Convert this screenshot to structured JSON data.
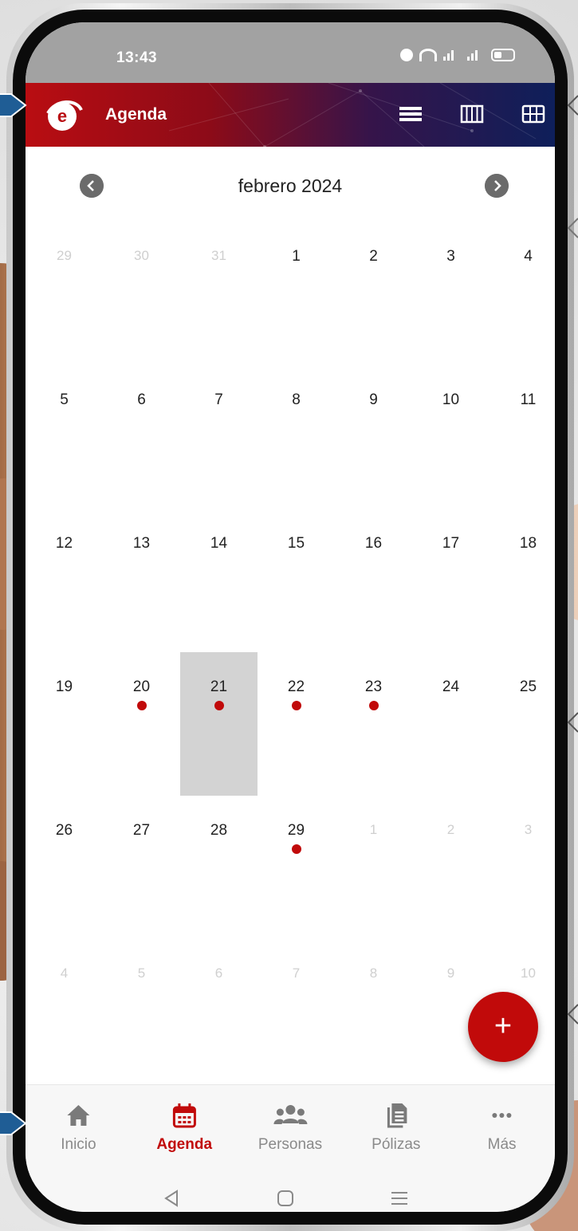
{
  "status_bar": {
    "time": "13:43"
  },
  "app_bar": {
    "title": "Agenda"
  },
  "calendar": {
    "month_label": "febrero 2024",
    "weeks": [
      [
        {
          "d": "29",
          "m": true
        },
        {
          "d": "30",
          "m": true
        },
        {
          "d": "31",
          "m": true
        },
        {
          "d": "1"
        },
        {
          "d": "2"
        },
        {
          "d": "3"
        },
        {
          "d": "4"
        }
      ],
      [
        {
          "d": "5"
        },
        {
          "d": "6"
        },
        {
          "d": "7"
        },
        {
          "d": "8"
        },
        {
          "d": "9"
        },
        {
          "d": "10"
        },
        {
          "d": "11"
        }
      ],
      [
        {
          "d": "12"
        },
        {
          "d": "13"
        },
        {
          "d": "14"
        },
        {
          "d": "15"
        },
        {
          "d": "16"
        },
        {
          "d": "17"
        },
        {
          "d": "18"
        }
      ],
      [
        {
          "d": "19"
        },
        {
          "d": "20",
          "dot": true
        },
        {
          "d": "21",
          "dot": true,
          "selected": true
        },
        {
          "d": "22",
          "dot": true
        },
        {
          "d": "23",
          "dot": true
        },
        {
          "d": "24"
        },
        {
          "d": "25"
        }
      ],
      [
        {
          "d": "26"
        },
        {
          "d": "27"
        },
        {
          "d": "28"
        },
        {
          "d": "29",
          "dot": true
        },
        {
          "d": "1",
          "m": true
        },
        {
          "d": "2",
          "m": true
        },
        {
          "d": "3",
          "m": true
        }
      ],
      [
        {
          "d": "4",
          "m": true
        },
        {
          "d": "5",
          "m": true
        },
        {
          "d": "6",
          "m": true
        },
        {
          "d": "7",
          "m": true
        },
        {
          "d": "8",
          "m": true
        },
        {
          "d": "9",
          "m": true
        },
        {
          "d": "10",
          "m": true
        }
      ]
    ]
  },
  "fab": {
    "label": "+"
  },
  "bottom_nav": {
    "tabs": [
      {
        "label": "Inicio",
        "icon": "home-icon"
      },
      {
        "label": "Agenda",
        "icon": "calendar-icon",
        "active": true
      },
      {
        "label": "Personas",
        "icon": "people-icon"
      },
      {
        "label": "Pólizas",
        "icon": "document-icon"
      },
      {
        "label": "Más",
        "icon": "more-icon"
      }
    ]
  },
  "colors": {
    "accent": "#c10a0a",
    "appbar_start": "#b90d12",
    "appbar_end": "#0e1f5a",
    "selected_day": "#d3d3d3"
  }
}
